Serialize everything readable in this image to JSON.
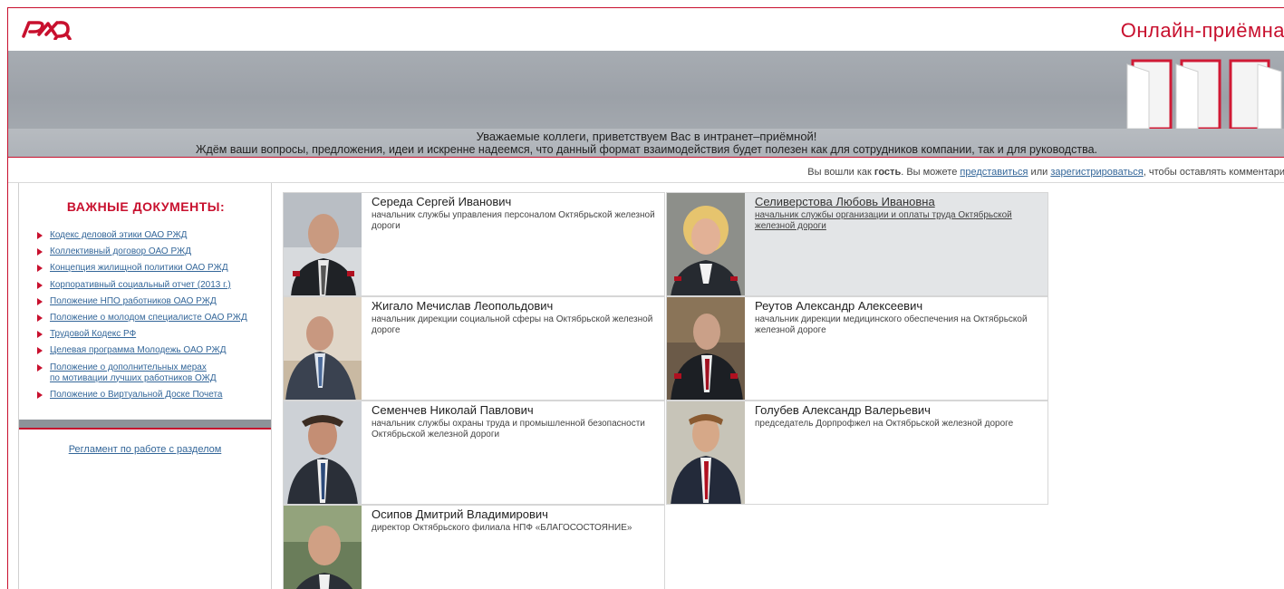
{
  "header": {
    "logo_text": "РЖД",
    "site_title": "Онлайн-приёмна"
  },
  "greeting": {
    "line1": "Уважаемые коллеги, приветствуем Вас в интранет–приёмной!",
    "line2": "Ждём ваши вопросы, предложения, идеи и искренне надеемся, что данный формат взаимодействия будет полезен как для сотрудников компании, так и для руководства."
  },
  "login_bar": {
    "prefix": "Вы вошли как ",
    "guest": "гость",
    "middle": ". Вы можете ",
    "introduce_link": "представиться",
    "or_text": " или ",
    "register_link": "зарегистрироваться",
    "suffix": ", чтобы оставлять комментари"
  },
  "sidebar": {
    "title": "ВАЖНЫЕ ДОКУМЕНТЫ:",
    "documents": [
      "Кодекс деловой этики ОАО РЖД",
      "Коллективный договор ОАО РЖД",
      "Концепция жилищной политики ОАО РЖД",
      "Корпоративный социальный отчет (2013 г.)",
      "Положение НПО работников ОАО РЖД",
      "Положение о молодом специалисте ОАО РЖД",
      "Трудовой Кодекс РФ",
      "Целевая программа Молодежь ОАО РЖД",
      "Положение о дополнительных мерах\nпо мотивации лучших работников ОЖД",
      "Положение о Виртуальной Доске Почета"
    ],
    "reglament_link": "Регламент по работе с разделом"
  },
  "people": [
    {
      "name": "Середа Сергей Иванович",
      "position": "начальник службы управления персоналом Октябрьской железной дороги",
      "highlighted": false
    },
    {
      "name": "Селиверстова Любовь Ивановна",
      "position": "начальник службы организации и оплаты труда Октябрьской железной дороги",
      "highlighted": true
    },
    {
      "name": "Жигало Мечислав Леопольдович",
      "position": "начальник дирекции социальной сферы на Октябрьской железной дороге",
      "highlighted": false
    },
    {
      "name": "Реутов Александр Алексеевич",
      "position": "начальник дирекции медицинского обеспечения на Октябрьской железной дороге",
      "highlighted": false
    },
    {
      "name": "Семенчев Николай Павлович",
      "position": "начальник службы охраны труда и промышленной безопасности Октябрьской железной дороги",
      "highlighted": false
    },
    {
      "name": "Голубев Александр Валерьевич",
      "position": "председатель Дорпрофжел на Октябрьской железной дороге",
      "highlighted": false
    },
    {
      "name": "Осипов Дмитрий Владимирович",
      "position": "директор Октябрьского филиала НПФ «БЛАГОСОСТОЯНИЕ»",
      "highlighted": false
    }
  ],
  "colors": {
    "brand_red": "#c8102e",
    "link_blue": "#336699",
    "banner_gray": "#a3a8ae"
  }
}
